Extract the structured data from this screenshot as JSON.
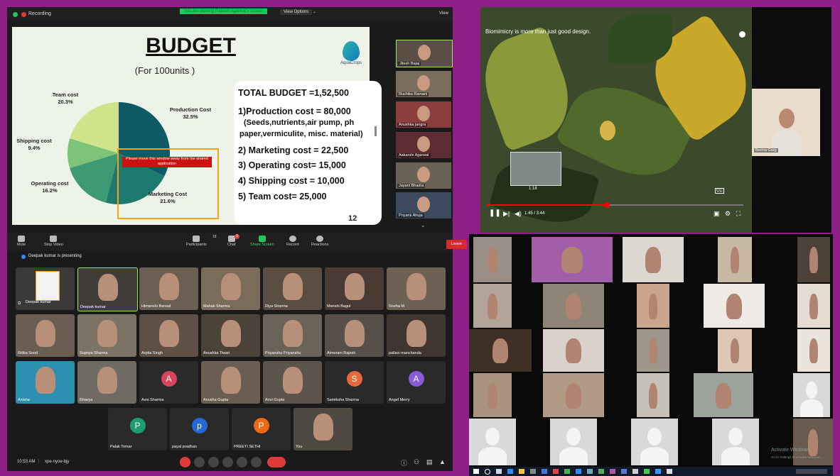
{
  "topbar": {
    "recording": "Recording",
    "viewing_notice": "You are viewing Rakesh Agarwal's screen",
    "view_options": "View Options",
    "view": "View"
  },
  "slide": {
    "title": "BUDGET",
    "subtitle": "(For 100units )",
    "logo_text": "AquaCrops",
    "total": "TOTAL BUDGET =1,52,500",
    "lines": [
      "1)Production cost = 80,000",
      "(Seeds,nutrients,air pump, ph",
      "paper,vermiculite, misc. material)",
      "2) Marketing cost = 22,500",
      "3) Operating cost= 15,000",
      "4) Shipping cost = 10,000",
      "5) Team cost= 25,000"
    ],
    "notice": "Please move this window away from the shared application",
    "page_number": "12"
  },
  "chart_data": {
    "type": "pie",
    "labels": [
      "Production Cost",
      "Marketing Cost",
      "Operating cost",
      "Shipping cost",
      "Team cost"
    ],
    "values": [
      32.5,
      21.6,
      16.2,
      9.4,
      20.3
    ],
    "value_labels": [
      "32.5%",
      "21.6%",
      "16.2%",
      "9.4%",
      "20.3%"
    ],
    "colors": [
      "#0e5b66",
      "#1e7a6e",
      "#3d9a73",
      "#7cc47a",
      "#cfe38a"
    ]
  },
  "thumbnails": [
    {
      "name": "Jitesh Bajaj"
    },
    {
      "name": "Ruchika Ramani"
    },
    {
      "name": "Anushka jangra"
    },
    {
      "name": "Aakarshi Agarwal"
    },
    {
      "name": "Jayant Bhadra"
    },
    {
      "name": "Priyank Ahuja"
    }
  ],
  "controls": {
    "mute": "Mute",
    "stop_video": "Stop Video",
    "participants": "Participants",
    "participants_count": "18",
    "chat": "Chat",
    "chat_badge": "9",
    "share_screen": "Share Screen",
    "record": "Record",
    "reactions": "Reactions",
    "leave": "Leave"
  },
  "presenting": "Deepak kumar is presenting",
  "participants": [
    {
      "name": "Deepak kumar"
    },
    {
      "name": "Deepak kumar"
    },
    {
      "name": "Himanshi Bansal"
    },
    {
      "name": "Mahak Sharma"
    },
    {
      "name": "Riya Sharma"
    },
    {
      "name": "Manshi Bagul"
    },
    {
      "name": "Sneha M"
    },
    {
      "name": "Ritika Sood"
    },
    {
      "name": "Supriya Sharma"
    },
    {
      "name": "Arpita Singh"
    },
    {
      "name": "Anushka Tiwari"
    },
    {
      "name": "Priyanshu Priyanshu"
    },
    {
      "name": "Atmvrani Rajesh"
    },
    {
      "name": "pallavi manchanda"
    },
    {
      "name": "Anisha"
    },
    {
      "name": "Bhavya"
    },
    {
      "name": "Avni Sharma",
      "initial": "A"
    },
    {
      "name": "Anusha Gupta"
    },
    {
      "name": "Anvi Gupta"
    },
    {
      "name": "Samiksha Sharma",
      "initial": "S"
    },
    {
      "name": "Angel Merry",
      "initial": "A"
    },
    {
      "name": "Palak Tomar",
      "initial": "P"
    },
    {
      "name": "payal pradhan",
      "initial": "p"
    },
    {
      "name": "PREETI SETHI",
      "initial": "P"
    },
    {
      "name": "You"
    }
  ],
  "meeting": {
    "time": "10:53 AM",
    "code": "xpe-nyoe-bjy"
  },
  "video": {
    "title": "Biomimicry is more than just good design.",
    "time": "1:45 / 3:44",
    "hover_time": "1:18",
    "cc": "CC",
    "progress": 0.47
  },
  "side_person": {
    "name": "Beena Garg"
  },
  "watermark": {
    "line1": "Activate Windows",
    "line2": "Go to Settings to activate Windows."
  },
  "colors": {
    "frame": "#8e1f86",
    "accent_red": "#e03a3a",
    "progress_red": "#ff0000"
  }
}
